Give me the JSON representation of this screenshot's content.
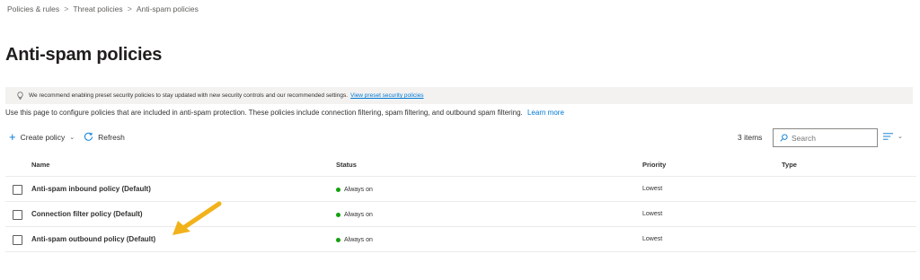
{
  "breadcrumb": {
    "items": [
      "Policies & rules",
      "Threat policies",
      "Anti-spam policies"
    ],
    "separator": ">"
  },
  "page": {
    "title": "Anti-spam policies"
  },
  "banner": {
    "text": "We recommend enabling preset security policies to stay updated with new security controls and our recommended settings.",
    "link": "View preset security policies",
    "icon": "lightbulb-icon"
  },
  "description": {
    "text": "Use this page to configure policies that are included in anti-spam protection. These policies include connection filtering, spam filtering, and outbound spam filtering.",
    "link": "Learn more"
  },
  "toolbar": {
    "create_label": "Create policy",
    "refresh_label": "Refresh",
    "items_count": "3 items",
    "search_placeholder": "Search"
  },
  "table": {
    "columns": [
      "Name",
      "Status",
      "Priority",
      "Type"
    ],
    "rows": [
      {
        "name": "Anti-spam inbound policy (Default)",
        "status": "Always on",
        "priority": "Lowest",
        "type": ""
      },
      {
        "name": "Connection filter policy (Default)",
        "status": "Always on",
        "priority": "Lowest",
        "type": ""
      },
      {
        "name": "Anti-spam outbound policy (Default)",
        "status": "Always on",
        "priority": "Lowest",
        "type": ""
      }
    ]
  },
  "colors": {
    "accent": "#0078d4",
    "status_on": "#13a10e",
    "annotation_arrow": "#f2b21b"
  }
}
